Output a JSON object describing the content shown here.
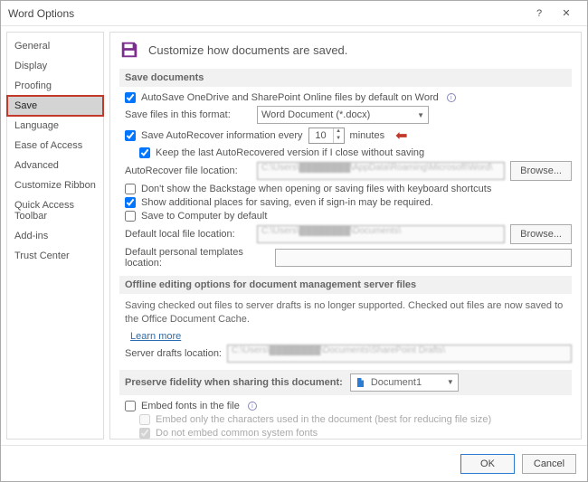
{
  "titlebar": {
    "title": "Word Options",
    "help": "?",
    "close": "✕"
  },
  "sidebar": {
    "items": [
      {
        "label": "General"
      },
      {
        "label": "Display"
      },
      {
        "label": "Proofing"
      },
      {
        "label": "Save"
      },
      {
        "label": "Language"
      },
      {
        "label": "Ease of Access"
      },
      {
        "label": "Advanced"
      },
      {
        "label": "Customize Ribbon"
      },
      {
        "label": "Quick Access Toolbar"
      },
      {
        "label": "Add-ins"
      },
      {
        "label": "Trust Center"
      }
    ],
    "selected_index": 3
  },
  "header": {
    "text": "Customize how documents are saved."
  },
  "sections": {
    "save_docs": {
      "title": "Save documents",
      "autosave": "AutoSave OneDrive and SharePoint Online files by default on Word",
      "format_label": "Save files in this format:",
      "format_value": "Word Document (*.docx)",
      "autorecover_prefix": "Save AutoRecover information every",
      "autorecover_value": "10",
      "autorecover_units": "minutes",
      "keep_last": "Keep the last AutoRecovered version if I close without saving",
      "ar_location_label": "AutoRecover file location:",
      "ar_location_value": "C:\\Users\\████████\\AppData\\Roaming\\Microsoft\\Word\\",
      "browse": "Browse...",
      "no_backstage": "Don't show the Backstage when opening or saving files with keyboard shortcuts",
      "more_places": "Show additional places for saving, even if sign-in may be required.",
      "save_to_computer": "Save to Computer by default",
      "default_local_label": "Default local file location:",
      "default_local_value": "C:\\Users\\████████\\Documents\\",
      "default_templates_label": "Default personal templates location:",
      "default_templates_value": ""
    },
    "offline": {
      "title": "Offline editing options for document management server files",
      "text": "Saving checked out files to server drafts is no longer supported. Checked out files are now saved to the Office Document Cache.",
      "learn_more": "Learn more",
      "server_drafts_label": "Server drafts location:",
      "server_drafts_value": "C:\\Users\\████████\\Documents\\SharePoint Drafts\\"
    },
    "preserve": {
      "title_prefix": "Preserve fidelity when sharing this document:",
      "doc_value": "Document1",
      "embed_fonts": "Embed fonts in the file",
      "embed_only": "Embed only the characters used in the document (best for reducing file size)",
      "no_common": "Do not embed common system fonts"
    }
  },
  "footer": {
    "ok": "OK",
    "cancel": "Cancel"
  }
}
